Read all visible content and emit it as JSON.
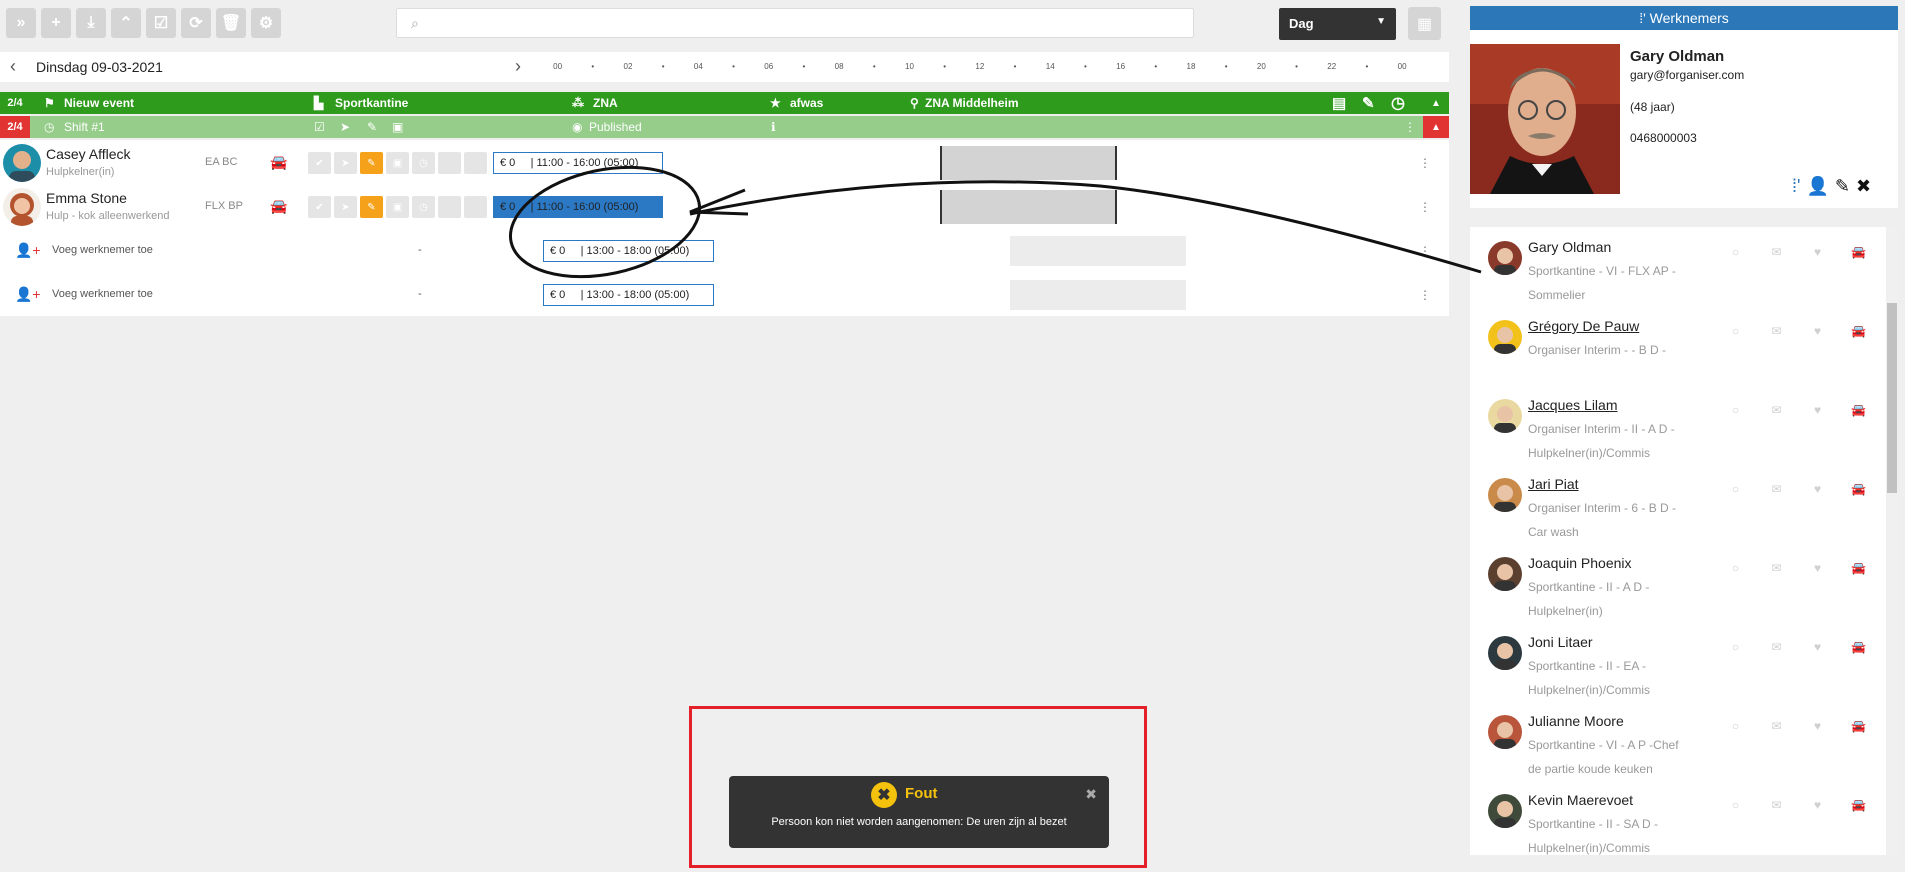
{
  "toolbar": {
    "icons": [
      "expand-icon",
      "add-icon",
      "download-icon",
      "collapse-icon",
      "calendar-check-icon",
      "refresh-icon",
      "trash-icon",
      "share-icon"
    ]
  },
  "search": {
    "placeholder": ""
  },
  "view_select": {
    "value": "Dag"
  },
  "datebar": {
    "date": "Dinsdag 09-03-2021",
    "hours": [
      "00",
      "•",
      "02",
      "•",
      "04",
      "•",
      "06",
      "•",
      "08",
      "•",
      "10",
      "•",
      "12",
      "•",
      "14",
      "•",
      "16",
      "•",
      "18",
      "•",
      "20",
      "•",
      "22",
      "•",
      "00"
    ]
  },
  "event": {
    "count": "2/4",
    "name": "Nieuw event",
    "location": "Sportkantine",
    "org": "ZNA",
    "task": "afwas",
    "place": "ZNA Middelheim"
  },
  "shift": {
    "count": "2/4",
    "name": "Shift #1",
    "status": "Published"
  },
  "employees": [
    {
      "name": "Casey Affleck",
      "sub": "Hulpkelner(in)",
      "code": "EA BC",
      "price": "€ 0",
      "time": "| 11:00 - 16:00 (05:00)"
    },
    {
      "name": "Emma Stone",
      "sub": "Hulp - kok alleenwerkend",
      "code": "FLX BP",
      "price": "€ 0",
      "time": "| 11:00 - 16:00 (05:00)"
    }
  ],
  "open_slots": [
    {
      "label": "Voeg werknemer toe",
      "dash": "-",
      "price": "€ 0",
      "time": "| 13:00 - 18:00 (05:00)"
    },
    {
      "label": "Voeg werknemer toe",
      "dash": "-",
      "price": "€ 0",
      "time": "| 13:00 - 18:00 (05:00)"
    }
  ],
  "panel": {
    "title": "Werknemers",
    "profile": {
      "name": "Gary Oldman",
      "email": "gary@forganiser.com",
      "age": "(48 jaar)",
      "phone": "0468000003"
    },
    "list": [
      {
        "name": "Gary Oldman",
        "underline": false,
        "sub": "Sportkantine - VI - FLX AP - Sommelier",
        "avatar": "#8a3a2a"
      },
      {
        "name": "Grégory De Pauw",
        "underline": true,
        "sub": "Organiser Interim - - B D -",
        "avatar": "#f2c21b"
      },
      {
        "name": "Jacques Lilam",
        "underline": true,
        "sub": "Organiser Interim - II - A D - Hulpkelner(in)/Commis",
        "avatar": "#e9d9a0"
      },
      {
        "name": "Jari Piat",
        "underline": true,
        "sub": "Organiser Interim - 6 - B D - Car wash",
        "avatar": "#c98a4a"
      },
      {
        "name": "Joaquin Phoenix",
        "underline": false,
        "sub": "Sportkantine - II - A D - Hulpkelner(in)",
        "avatar": "#5b4030"
      },
      {
        "name": "Joni Litaer",
        "underline": false,
        "sub": "Sportkantine - II - EA - Hulpkelner(in)/Commis",
        "avatar": "#2c3a40"
      },
      {
        "name": "Julianne Moore",
        "underline": false,
        "sub": "Sportkantine - VI - A P -Chef de partie koude keuken",
        "avatar": "#b8553a"
      },
      {
        "name": "Kevin Maerevoet",
        "underline": false,
        "sub": "Sportkantine - II - SA D - Hulpkelner(in)/Commis",
        "avatar": "#3f4a3a"
      }
    ]
  },
  "toast": {
    "title": "Fout",
    "message": "Persoon kon niet worden aangenomen: De uren zijn al bezet"
  }
}
